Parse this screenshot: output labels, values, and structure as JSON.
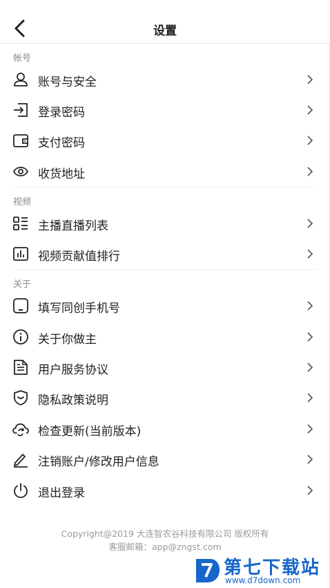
{
  "header": {
    "title": "设置",
    "back_icon": "chevron-left-icon"
  },
  "sections": [
    {
      "label": "帐号",
      "items": [
        {
          "label": "账号与安全",
          "icon": "user-icon"
        },
        {
          "label": "登录密码",
          "icon": "login-icon"
        },
        {
          "label": "支付密码",
          "icon": "wallet-icon"
        },
        {
          "label": "收货地址",
          "icon": "location-icon"
        }
      ]
    },
    {
      "label": "视频",
      "items": [
        {
          "label": "主播直播列表",
          "icon": "list-grid-icon"
        },
        {
          "label": "视频贡献值排行",
          "icon": "bar-chart-icon"
        }
      ]
    },
    {
      "label": "关于",
      "items": [
        {
          "label": "填写同创手机号",
          "icon": "phone-icon"
        },
        {
          "label": "关于你做主",
          "icon": "info-icon"
        },
        {
          "label": "用户服务协议",
          "icon": "document-icon"
        },
        {
          "label": "隐私政策说明",
          "icon": "shield-icon"
        },
        {
          "label": "检查更新(当前版本)",
          "icon": "cloud-refresh-icon"
        },
        {
          "label": "注销账户/修改用户信息",
          "icon": "pen-icon"
        },
        {
          "label": "退出登录",
          "icon": "power-icon"
        }
      ]
    }
  ],
  "footer": {
    "copyright": "Copyright@2019 大连智农谷科技有限公司 版权所有",
    "service": "客服邮箱：app@zngst.com"
  },
  "watermark": {
    "name": "第七下载站",
    "url": "www.d7down.com"
  },
  "colors": {
    "text": "#222222",
    "muted": "#8a8a8a",
    "divider": "#efefef",
    "watermark": "#1766c9"
  }
}
